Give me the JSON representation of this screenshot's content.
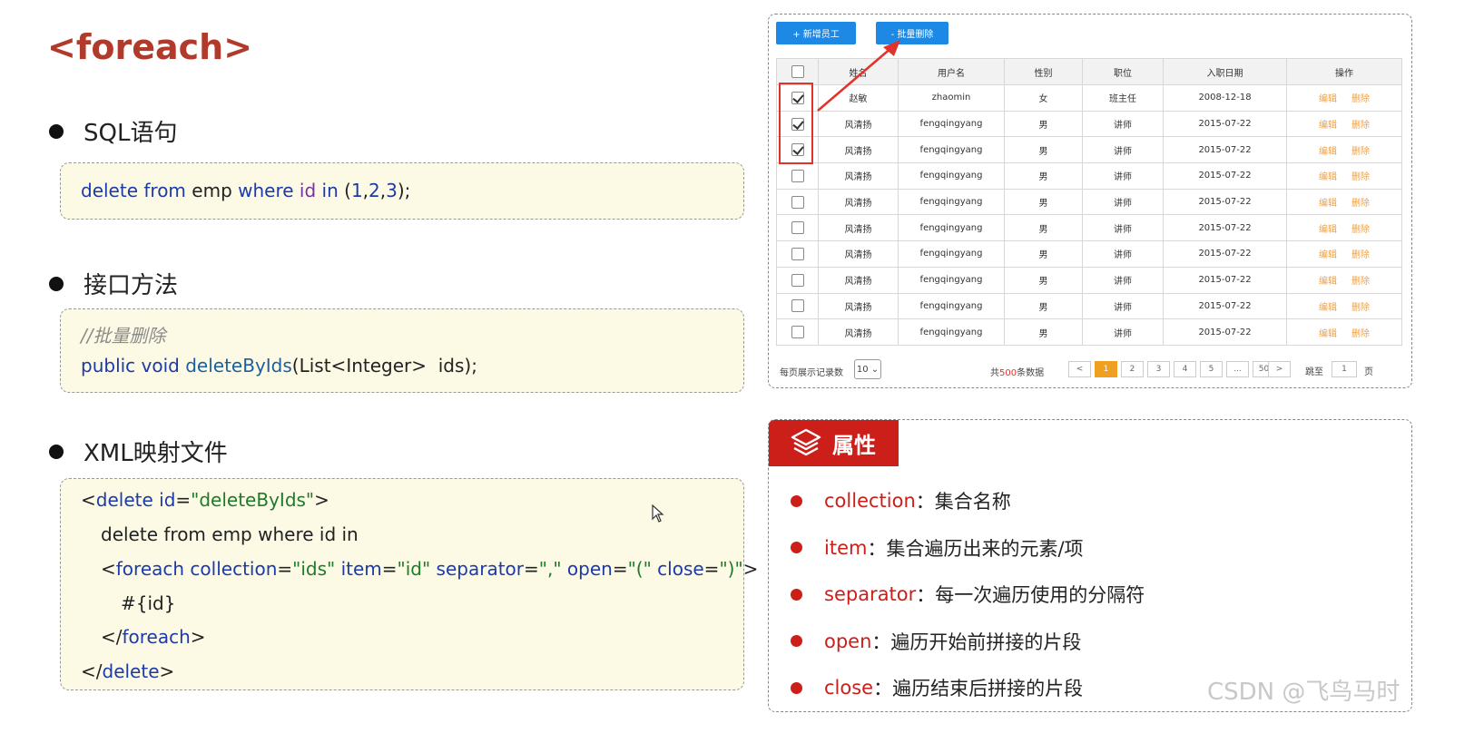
{
  "title": "<foreach>",
  "sections": {
    "sql": {
      "heading": "SQL语句"
    },
    "method": {
      "heading": "接口方法"
    },
    "xml": {
      "heading": "XML映射文件"
    }
  },
  "sql_code": {
    "t1": "delete from",
    "t2": " emp ",
    "t3": "where",
    "t4": " id",
    "t5": " in",
    "t6": " (",
    "n1": "1",
    "c1": ",",
    "n2": "2",
    "c2": ",",
    "n3": "3",
    "t7": ");"
  },
  "method_code": {
    "comment": "//批量删除",
    "kw": "public void ",
    "name": "deleteByIds",
    "params": "(List<Integer>  ids);"
  },
  "xml_code": {
    "l1a": "<",
    "l1b": "delete",
    "l1c": " id",
    "l1d": "=",
    "l1e": "\"deleteByIds\"",
    "l1f": ">",
    "l2": "delete from emp where id in",
    "l3a": "<",
    "l3b": "foreach",
    "l3c": " collection",
    "l3d": "=",
    "l3e": "\"ids\"",
    "l3f": " item",
    "l3g": "=",
    "l3h": "\"id\"",
    "l3i": " separator",
    "l3j": "=",
    "l3k": "\",\"",
    "l3l": " open",
    "l3m": "=",
    "l3n": "\"(\"",
    "l3o": " close",
    "l3p": "=",
    "l3q": "\")\"",
    "l3r": ">",
    "l4": "#{id}",
    "l5a": "</",
    "l5b": "foreach",
    "l5c": ">",
    "l6a": "</",
    "l6b": "delete",
    "l6c": ">"
  },
  "table_ui": {
    "add_button": "+ 新增员工",
    "batch_delete_button": "- 批量删除",
    "columns": [
      "姓名",
      "用户名",
      "性别",
      "职位",
      "入职日期",
      "操作"
    ],
    "rows": [
      {
        "checked": true,
        "name": "赵敏",
        "username": "zhaomin",
        "gender": "女",
        "position": "班主任",
        "date": "2008-12-18"
      },
      {
        "checked": true,
        "name": "风清扬",
        "username": "fengqingyang",
        "gender": "男",
        "position": "讲师",
        "date": "2015-07-22"
      },
      {
        "checked": true,
        "name": "风清扬",
        "username": "fengqingyang",
        "gender": "男",
        "position": "讲师",
        "date": "2015-07-22"
      },
      {
        "checked": false,
        "name": "风清扬",
        "username": "fengqingyang",
        "gender": "男",
        "position": "讲师",
        "date": "2015-07-22"
      },
      {
        "checked": false,
        "name": "风清扬",
        "username": "fengqingyang",
        "gender": "男",
        "position": "讲师",
        "date": "2015-07-22"
      },
      {
        "checked": false,
        "name": "风清扬",
        "username": "fengqingyang",
        "gender": "男",
        "position": "讲师",
        "date": "2015-07-22"
      },
      {
        "checked": false,
        "name": "风清扬",
        "username": "fengqingyang",
        "gender": "男",
        "position": "讲师",
        "date": "2015-07-22"
      },
      {
        "checked": false,
        "name": "风清扬",
        "username": "fengqingyang",
        "gender": "男",
        "position": "讲师",
        "date": "2015-07-22"
      },
      {
        "checked": false,
        "name": "风清扬",
        "username": "fengqingyang",
        "gender": "男",
        "position": "讲师",
        "date": "2015-07-22"
      },
      {
        "checked": false,
        "name": "风清扬",
        "username": "fengqingyang",
        "gender": "男",
        "position": "讲师",
        "date": "2015-07-22"
      }
    ],
    "edit_label": "编辑",
    "delete_label": "删除",
    "pager": {
      "per_page_label": "每页展示记录数",
      "per_page_value": "10",
      "total_prefix": "共",
      "total_count": "500",
      "total_suffix": "条数据",
      "prev": "<",
      "pages": [
        "1",
        "2",
        "3",
        "4",
        "5",
        "...",
        "50"
      ],
      "next": ">",
      "jump_label": "跳至",
      "jump_value": "1",
      "page_unit": "页"
    }
  },
  "attributes": {
    "header": "属性",
    "items": [
      {
        "key": "collection",
        "sep": "：",
        "desc": "集合名称"
      },
      {
        "key": "item",
        "sep": "：",
        "desc": "集合遍历出来的元素/项"
      },
      {
        "key": "separator",
        "sep": "：",
        "desc": "每一次遍历使用的分隔符"
      },
      {
        "key": "open",
        "sep": "：",
        "desc": "遍历开始前拼接的片段"
      },
      {
        "key": "close",
        "sep": "：",
        "desc": "遍历结束后拼接的片段"
      }
    ]
  },
  "watermark": "CSDN @飞鸟马时",
  "colors": {
    "accent_red": "#cc1f1a",
    "title_red": "#b23a2a",
    "button_blue": "#1e88e5",
    "code_bg": "#fcfae5"
  }
}
